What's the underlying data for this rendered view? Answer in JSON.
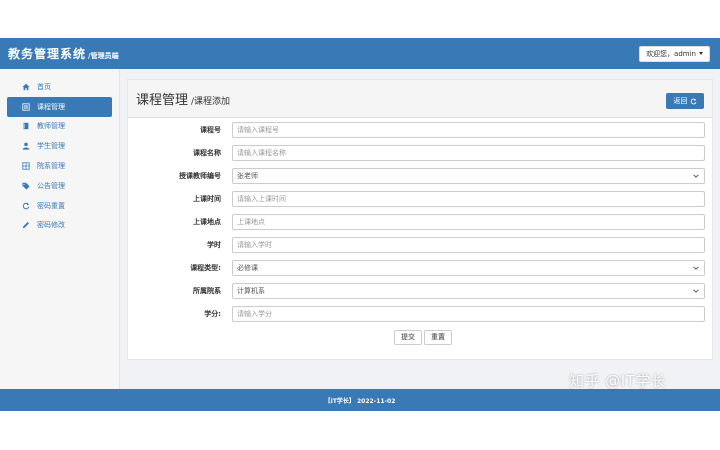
{
  "header": {
    "title": "教务管理系统",
    "subtitle": "/管理员端",
    "user_menu": "欢迎您，admin"
  },
  "sidebar": {
    "items": [
      {
        "label": "首页",
        "icon": "home-icon",
        "active": false
      },
      {
        "label": "课程管理",
        "icon": "list-icon",
        "active": true
      },
      {
        "label": "教师管理",
        "icon": "book-icon",
        "active": false
      },
      {
        "label": "学生管理",
        "icon": "user-icon",
        "active": false
      },
      {
        "label": "院系管理",
        "icon": "grid-icon",
        "active": false
      },
      {
        "label": "公告管理",
        "icon": "tags-icon",
        "active": false
      },
      {
        "label": "密码重置",
        "icon": "refresh-icon",
        "active": false
      },
      {
        "label": "密码修改",
        "icon": "pencil-icon",
        "active": false
      }
    ]
  },
  "panel": {
    "title": "课程管理",
    "subtitle": "/课程添加",
    "back_label": "返回"
  },
  "form": {
    "fields": [
      {
        "label": "课程号",
        "placeholder": "请输入课程号",
        "value": ""
      },
      {
        "label": "课程名称",
        "placeholder": "请输入课程名称",
        "value": ""
      },
      {
        "label": "授课教师编号",
        "placeholder": "",
        "value": "张老师",
        "select": true
      },
      {
        "label": "上课时间",
        "placeholder": "请输入上课时间",
        "value": ""
      },
      {
        "label": "上课地点",
        "placeholder": "上课地点",
        "value": ""
      },
      {
        "label": "学时",
        "placeholder": "请输入学时",
        "value": ""
      },
      {
        "label": "课程类型:",
        "placeholder": "",
        "value": "必修课",
        "select": true
      },
      {
        "label": "所属院系",
        "placeholder": "",
        "value": "计算机系",
        "select": true
      },
      {
        "label": "学分:",
        "placeholder": "请输入学分",
        "value": ""
      }
    ],
    "submit_label": "提交",
    "reset_label": "重置"
  },
  "footer": {
    "text": "【IT学长】 2022-11-02"
  },
  "watermark": "知乎 @IT学长",
  "colors": {
    "primary": "#3879b6",
    "sidebar_bg": "#f6f6f6",
    "page_bg": "#f0f2f5"
  }
}
